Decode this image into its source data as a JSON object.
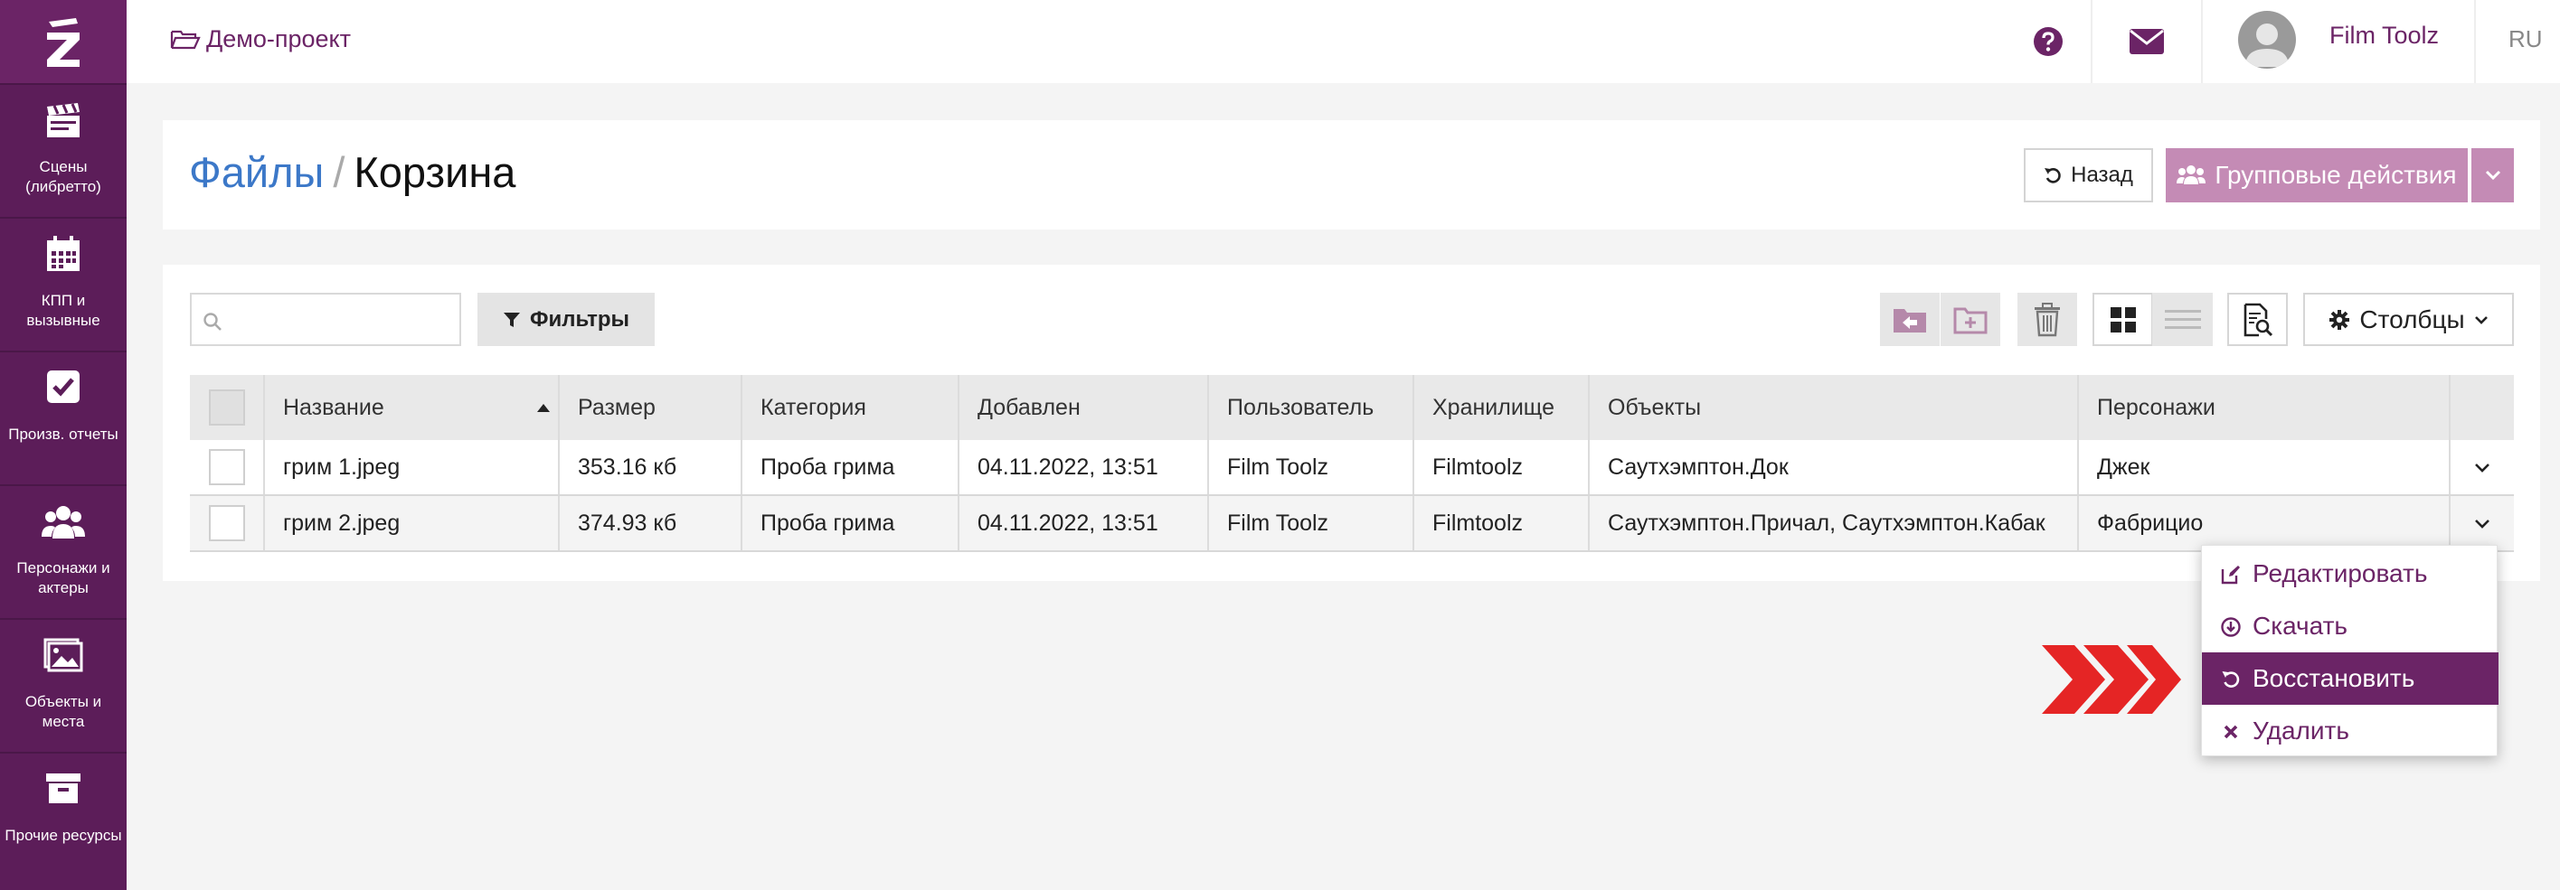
{
  "colors": {
    "brand": "#6b2466",
    "sidebar": "#5c1d59",
    "link_blue": "#3c78c8",
    "group_btn": "#c48bb5",
    "annotation_red": "#e52525"
  },
  "sidebar": {
    "logo_icon": "z-logo-icon",
    "items": [
      {
        "label": "Сцены (либретто)",
        "icon": "clapperboard-icon"
      },
      {
        "label": "КПП и вызывные",
        "icon": "calendar-icon"
      },
      {
        "label": "Произв. отчеты",
        "icon": "checkbox-icon"
      },
      {
        "label": "Персонажи и актеры",
        "icon": "users-icon"
      },
      {
        "label": "Объекты и места",
        "icon": "image-icon"
      },
      {
        "label": "Прочие ресурсы",
        "icon": "archive-icon"
      }
    ]
  },
  "topbar": {
    "project": "Демо-проект",
    "username": "Film Toolz",
    "language": "RU",
    "help_icon": "question-circle-icon",
    "mail_icon": "envelope-icon"
  },
  "header": {
    "breadcrumb_parent": "Файлы",
    "breadcrumb_separator": "/",
    "breadcrumb_current": "Корзина",
    "back_label": "Назад",
    "group_actions_label": "Групповые действия"
  },
  "toolbar": {
    "search_placeholder": "",
    "search_value": "",
    "filters_label": "Фильтры",
    "columns_label": "Столбцы"
  },
  "table": {
    "columns": [
      "Название",
      "Размер",
      "Категория",
      "Добавлен",
      "Пользователь",
      "Хранилище",
      "Объекты",
      "Персонажи"
    ],
    "sort_column": "Название",
    "sort_direction": "asc",
    "rows": [
      {
        "name": "грим 1.jpeg",
        "size": "353.16 кб",
        "category": "Проба грима",
        "added": "04.11.2022, 13:51",
        "user": "Film Toolz",
        "storage": "Filmtoolz",
        "objects": "Саутхэмптон.Док",
        "characters": "Джек"
      },
      {
        "name": "грим 2.jpeg",
        "size": "374.93 кб",
        "category": "Проба грима",
        "added": "04.11.2022, 13:51",
        "user": "Film Toolz",
        "storage": "Filmtoolz",
        "objects": "Саутхэмптон.Причал, Саутхэмптон.Кабак",
        "characters": "Фабрицио"
      }
    ]
  },
  "row_menu": {
    "items": [
      {
        "label": "Редактировать",
        "icon": "edit-icon"
      },
      {
        "label": "Скачать",
        "icon": "download-icon"
      },
      {
        "label": "Восстановить",
        "icon": "restore-icon",
        "active": true
      },
      {
        "label": "Удалить",
        "icon": "close-icon"
      }
    ]
  }
}
